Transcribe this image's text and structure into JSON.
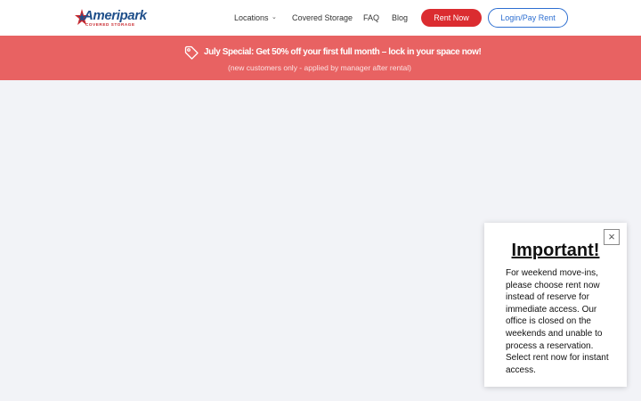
{
  "header": {
    "logo": {
      "name": "Ameripark",
      "tagline": "COVERED STORAGE"
    },
    "nav": [
      {
        "label": "Locations",
        "has_dropdown": true
      },
      {
        "label": "Covered Storage"
      },
      {
        "label": "FAQ"
      },
      {
        "label": "Blog"
      }
    ],
    "rent_button": "Rent Now",
    "login_button": "Login/Pay Rent"
  },
  "promo_banner": {
    "icon": "tag-icon",
    "headline": "July Special: Get 50% off your first full month – lock in your space now!",
    "note": "(new customers only - applied by manager after rental)"
  },
  "popup": {
    "close_glyph": "×",
    "title": "Important!",
    "body": "For weekend move-ins, please choose rent now instead of reserve for immediate access. Our office is closed on the weekends and unable to process a reservation. Select rent now for instant access."
  },
  "colors": {
    "banner_bg": "#e86262",
    "rent_button_bg": "#db2c30",
    "login_button_accent": "#2e6fd1",
    "page_bg": "#f2f3f7"
  }
}
